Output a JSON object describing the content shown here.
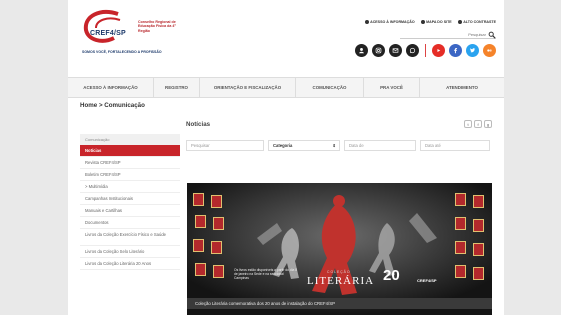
{
  "header": {
    "logo_text": "CREF4/SP",
    "council_text": "Conselho Regional de Educação Física da 4ª Região",
    "slogan": "SOMOS VOCÊ, FORTALECENDO A PROFISSÃO",
    "top_links": [
      "ACESSO À INFORMAÇÃO",
      "MAPA DO SITE",
      "ALTO CONTRASTE"
    ],
    "search_placeholder": "Pesquisar",
    "social_icons": [
      "user-icon",
      "instagram-icon",
      "email-icon",
      "whatsapp-icon",
      "youtube-icon",
      "facebook-icon",
      "twitter-icon",
      "flickr-icon"
    ],
    "brand_red": "#c8242a",
    "brand_blue": "#1d3a6b"
  },
  "nav": {
    "items": [
      "ACESSO À INFORMAÇÃO",
      "REGISTRO",
      "ORIENTAÇÃO E FISCALIZAÇÃO",
      "COMUNICAÇÃO",
      "PRA VOCÊ",
      "ATENDIMENTO"
    ]
  },
  "breadcrumb": {
    "home": "Home",
    "separator": ">",
    "current": "Comunicação"
  },
  "sidebar": {
    "heading": "Comunicação",
    "items": [
      "Notícias",
      "Revista CREF4/SP",
      "Boletim CREF4/SP",
      "> Multimídia",
      "Campanhas Institucionais",
      "Manuais e Cartilhas",
      "Documentos",
      "Livros da Coleção Exercício Físico e Saúde",
      "Livros da Coleção Selo Literário",
      "Livros da Coleção Literária 20 Anos"
    ]
  },
  "main": {
    "title": "Notícias",
    "share_icons": [
      "twitter-icon",
      "facebook-icon",
      "google-plus-icon"
    ],
    "filters": {
      "search_placeholder": "Pesquisar",
      "category_label": "Categoria",
      "date_from_placeholder": "Data de",
      "date_to_placeholder": "Data até"
    },
    "banner": {
      "literary_prefix": "COLEÇÃO",
      "literary_title": "LITERÁRIA",
      "twenty": "20",
      "logo": "CREF4/SP",
      "announcement": "Os livros estão disponíveis a partir do dia 8 de janeiro na Sede e na seccional Campinas"
    },
    "caption": "Coleção Literária comemorativa dos 20 anos de instalação do CREF4/SP"
  }
}
